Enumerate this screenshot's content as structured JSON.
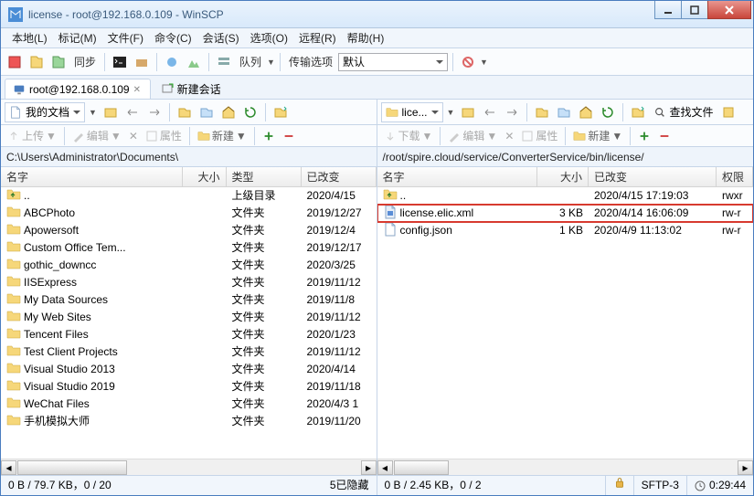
{
  "window": {
    "title": "license - root@192.168.0.109 - WinSCP"
  },
  "menu": [
    "本地(L)",
    "标记(M)",
    "文件(F)",
    "命令(C)",
    "会话(S)",
    "选项(O)",
    "远程(R)",
    "帮助(H)"
  ],
  "toolbar": {
    "sync_label": "同步",
    "queue_label": "队列",
    "transfer_label": "传输选项",
    "transfer_value": "默认"
  },
  "session": {
    "active_tab": "root@192.168.0.109",
    "new_tab": "新建会话"
  },
  "left": {
    "location": "我的文档",
    "action_upload": "上传",
    "action_edit": "编辑",
    "action_props": "属性",
    "action_new": "新建",
    "path": "C:\\Users\\Administrator\\Documents\\",
    "find_label": "查找文件",
    "headers": {
      "name": "名字",
      "size": "大小",
      "type": "类型",
      "date": "已改变"
    },
    "rows": [
      {
        "name": "..",
        "type": "上级目录",
        "date": "2020/4/15",
        "icon": "up"
      },
      {
        "name": "ABCPhoto",
        "type": "文件夹",
        "date": "2019/12/27",
        "icon": "folder"
      },
      {
        "name": "Apowersoft",
        "type": "文件夹",
        "date": "2019/12/4",
        "icon": "folder"
      },
      {
        "name": "Custom Office Tem...",
        "type": "文件夹",
        "date": "2019/12/17",
        "icon": "folder"
      },
      {
        "name": "gothic_downcc",
        "type": "文件夹",
        "date": "2020/3/25",
        "icon": "folder"
      },
      {
        "name": "IISExpress",
        "type": "文件夹",
        "date": "2019/11/12",
        "icon": "folder"
      },
      {
        "name": "My Data Sources",
        "type": "文件夹",
        "date": "2019/11/8",
        "icon": "folder"
      },
      {
        "name": "My Web Sites",
        "type": "文件夹",
        "date": "2019/11/12",
        "icon": "folder"
      },
      {
        "name": "Tencent Files",
        "type": "文件夹",
        "date": "2020/1/23",
        "icon": "folder"
      },
      {
        "name": "Test Client Projects",
        "type": "文件夹",
        "date": "2019/11/12",
        "icon": "folder"
      },
      {
        "name": "Visual Studio 2013",
        "type": "文件夹",
        "date": "2020/4/14",
        "icon": "folder"
      },
      {
        "name": "Visual Studio 2019",
        "type": "文件夹",
        "date": "2019/11/18",
        "icon": "folder"
      },
      {
        "name": "WeChat Files",
        "type": "文件夹",
        "date": "2020/4/3  1",
        "icon": "folder"
      },
      {
        "name": "手机模拟大师",
        "type": "文件夹",
        "date": "2019/11/20",
        "icon": "folder"
      }
    ],
    "status_left": "0 B / 79.7 KB，0 / 20",
    "status_right": "5已隐藏"
  },
  "right": {
    "location": "lice...",
    "action_download": "下载",
    "action_edit": "编辑",
    "action_props": "属性",
    "action_new": "新建",
    "path": "/root/spire.cloud/service/ConverterService/bin/license/",
    "find_label": "查找文件",
    "headers": {
      "name": "名字",
      "size": "大小",
      "date": "已改变",
      "perm": "权限"
    },
    "rows": [
      {
        "name": "..",
        "size": "",
        "date": "2020/4/15 17:19:03",
        "perm": "rwxr",
        "icon": "up",
        "hl": false
      },
      {
        "name": "license.elic.xml",
        "size": "3 KB",
        "date": "2020/4/14 16:06:09",
        "perm": "rw-r",
        "icon": "assoc",
        "hl": true
      },
      {
        "name": "config.json",
        "size": "1 KB",
        "date": "2020/4/9 11:13:02",
        "perm": "rw-r",
        "icon": "doc",
        "hl": false
      }
    ],
    "status": "0 B / 2.45 KB，0 / 2"
  },
  "statusbar": {
    "protocol": "SFTP-3",
    "time": "0:29:44"
  }
}
